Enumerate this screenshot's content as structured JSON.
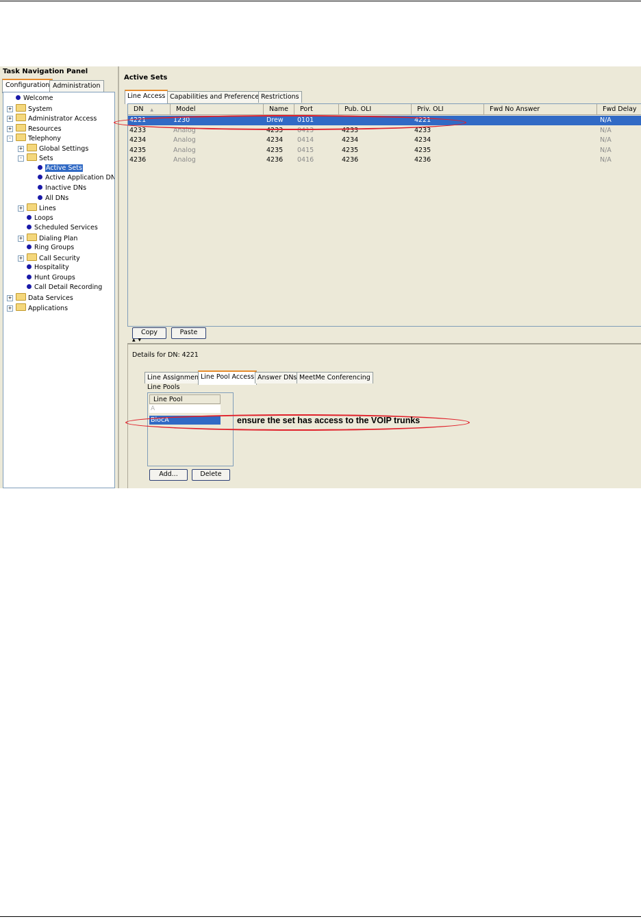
{
  "nav": {
    "title": "Task Navigation Panel",
    "tabs": [
      "Configuration",
      "Administration"
    ],
    "active_tab": "Configuration",
    "tree": [
      {
        "label": "Welcome",
        "icon": "dot-icon",
        "level": 0,
        "expander": "",
        "selected": false
      },
      {
        "label": "System",
        "icon": "folder-icon",
        "level": 0,
        "expander": "+",
        "selected": false
      },
      {
        "label": "Administrator Access",
        "icon": "folder-icon",
        "level": 0,
        "expander": "+",
        "selected": false
      },
      {
        "label": "Resources",
        "icon": "folder-icon",
        "level": 0,
        "expander": "+",
        "selected": false
      },
      {
        "label": "Telephony",
        "icon": "folder-icon",
        "level": 0,
        "expander": "-",
        "selected": false
      },
      {
        "label": "Global Settings",
        "icon": "folder-icon",
        "level": 1,
        "expander": "+",
        "selected": false
      },
      {
        "label": "Sets",
        "icon": "folder-icon",
        "level": 1,
        "expander": "-",
        "selected": false
      },
      {
        "label": "Active Sets",
        "icon": "dot-icon",
        "level": 2,
        "expander": "",
        "selected": true
      },
      {
        "label": "Active Application DNs",
        "icon": "dot-icon",
        "level": 2,
        "expander": "",
        "selected": false
      },
      {
        "label": "Inactive DNs",
        "icon": "dot-icon",
        "level": 2,
        "expander": "",
        "selected": false
      },
      {
        "label": "All DNs",
        "icon": "dot-icon",
        "level": 2,
        "expander": "",
        "selected": false
      },
      {
        "label": "Lines",
        "icon": "folder-icon",
        "level": 1,
        "expander": "+",
        "selected": false
      },
      {
        "label": "Loops",
        "icon": "dot-icon",
        "level": 1,
        "expander": "",
        "selected": false
      },
      {
        "label": "Scheduled Services",
        "icon": "dot-icon",
        "level": 1,
        "expander": "",
        "selected": false
      },
      {
        "label": "Dialing Plan",
        "icon": "folder-icon",
        "level": 1,
        "expander": "+",
        "selected": false
      },
      {
        "label": "Ring Groups",
        "icon": "dot-icon",
        "level": 1,
        "expander": "",
        "selected": false
      },
      {
        "label": "Call Security",
        "icon": "folder-icon",
        "level": 1,
        "expander": "+",
        "selected": false
      },
      {
        "label": "Hospitality",
        "icon": "dot-icon",
        "level": 1,
        "expander": "",
        "selected": false
      },
      {
        "label": "Hunt Groups",
        "icon": "dot-icon",
        "level": 1,
        "expander": "",
        "selected": false
      },
      {
        "label": "Call Detail Recording",
        "icon": "dot-icon",
        "level": 1,
        "expander": "",
        "selected": false
      },
      {
        "label": "Data Services",
        "icon": "folder-icon",
        "level": 0,
        "expander": "+",
        "selected": false
      },
      {
        "label": "Applications",
        "icon": "folder-icon",
        "level": 0,
        "expander": "+",
        "selected": false
      }
    ]
  },
  "main": {
    "title": "Active Sets",
    "tabs": [
      "Line Access",
      "Capabilities and Preferences",
      "Restrictions"
    ],
    "active_tab": "Line Access",
    "columns": [
      "DN",
      "Model",
      "Name",
      "Port",
      "Pub. OLI",
      "Priv. OLI",
      "Fwd No Answer",
      "Fwd Delay"
    ],
    "sort_indicator": "▲",
    "rows": [
      {
        "dn": "4221",
        "model": "1230",
        "name": "Drew",
        "port": "0101",
        "pub_oli": "",
        "priv_oli": "4221",
        "fwd_no_answer": "",
        "fwd_delay": "N/A",
        "selected": true,
        "dim": false
      },
      {
        "dn": "4233",
        "model": "Analog",
        "name": "4233",
        "port": "0413",
        "pub_oli": "4233",
        "priv_oli": "4233",
        "fwd_no_answer": "",
        "fwd_delay": "N/A",
        "selected": false,
        "dim": true
      },
      {
        "dn": "4234",
        "model": "Analog",
        "name": "4234",
        "port": "0414",
        "pub_oli": "4234",
        "priv_oli": "4234",
        "fwd_no_answer": "",
        "fwd_delay": "N/A",
        "selected": false,
        "dim": true
      },
      {
        "dn": "4235",
        "model": "Analog",
        "name": "4235",
        "port": "0415",
        "pub_oli": "4235",
        "priv_oli": "4235",
        "fwd_no_answer": "",
        "fwd_delay": "N/A",
        "selected": false,
        "dim": true
      },
      {
        "dn": "4236",
        "model": "Analog",
        "name": "4236",
        "port": "0416",
        "pub_oli": "4236",
        "priv_oli": "4236",
        "fwd_no_answer": "",
        "fwd_delay": "N/A",
        "selected": false,
        "dim": true
      }
    ],
    "copy_label": "Copy",
    "paste_label": "Paste"
  },
  "details": {
    "label": "Details for DN: 4221",
    "tabs": [
      "Line Assignment",
      "Line Pool Access",
      "Answer DNs",
      "MeetMe Conferencing"
    ],
    "active_tab": "Line Pool Access",
    "line_pools_label": "Line Pools",
    "line_pool_header": "Line Pool",
    "line_pool_first": "A",
    "line_pool_selected": "BlocA",
    "add_label": "Add...",
    "delete_label": "Delete"
  },
  "annotation": {
    "note": "ensure the set has access to the VOIP trunks",
    "oval_color": "#e0202a"
  },
  "colors": {
    "selection": "#316ac5",
    "panel_bg": "#ece9d8",
    "tab_accent": "#e68b2c",
    "tree_dot": "#1a1aa8"
  }
}
